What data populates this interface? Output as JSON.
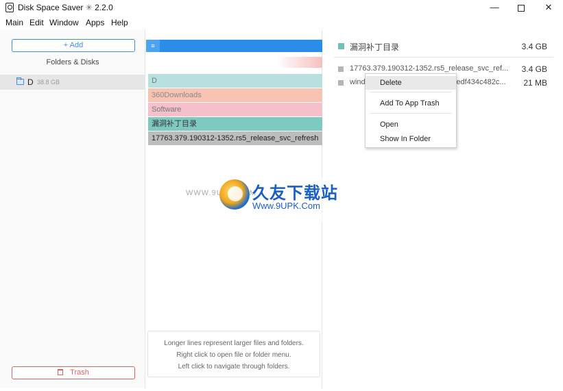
{
  "window": {
    "title": "Disk Space Saver",
    "version_symbol": "✳",
    "version": "2.2.0",
    "controls": {
      "minimize": "—",
      "maximize": "",
      "close": "✕"
    }
  },
  "menu": [
    "Main",
    "Edit",
    "Window",
    "Apps",
    "Help"
  ],
  "sidebar": {
    "add_label": "+ Add",
    "section_label": "Folders & Disks",
    "disk": {
      "name": "D",
      "size": "38.8 GB"
    },
    "trash_label": "Trash"
  },
  "breadcrumb": {
    "handle": "≡"
  },
  "levels": [
    {
      "label": "D",
      "color": "#b8e0de",
      "text_color": "#777777"
    },
    {
      "label": "360Downloads",
      "color": "#f7c3b2",
      "text_color": "#8a8a8a"
    },
    {
      "label": "Software",
      "color": "#f4c0cc",
      "text_color": "#777777"
    },
    {
      "label": "漏洞补丁目录",
      "color": "#7fcac0",
      "text_color": "#333333"
    },
    {
      "label": "17763.379.190312-1352.rs5_release_svc_refresh",
      "color": "#bdbdbd",
      "text_color": "#222222"
    }
  ],
  "hint": {
    "line1": "Longer lines represent larger files and folders.",
    "line2": "Right click to open file or folder menu.",
    "line3": "Left click to navigate through folders."
  },
  "details": {
    "header": {
      "name": "漏洞补丁目录",
      "size": "3.4 GB",
      "color": "#6cc2b8"
    },
    "items": [
      {
        "name": "17763.379.190312-1352.rs5_release_svc_ref...",
        "size": "3.4 GB"
      },
      {
        "name": "windows10.0-kb4489899-x64_7edf434c482c...",
        "size": "21 MB"
      }
    ]
  },
  "context_menu": {
    "delete": "Delete",
    "add_to_trash": "Add To App Trash",
    "open": "Open",
    "show_in_folder": "Show In Folder"
  },
  "watermark": {
    "cn_text": "久友下载站",
    "url": "Www.9UPK.Com",
    "faint": "WWW.9UPK.COM"
  }
}
